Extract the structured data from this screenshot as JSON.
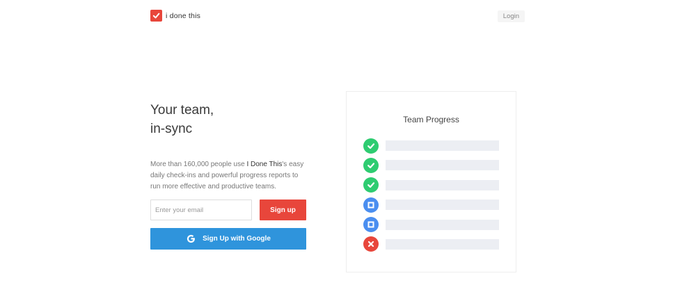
{
  "header": {
    "logo_text": "i done this",
    "login_label": "Login"
  },
  "hero": {
    "headline_line1": "Your team,",
    "headline_line2": "in-sync",
    "description_before": "More than 160,000 people use ",
    "description_brand": "I Done This",
    "description_after": "'s easy daily check-ins and powerful progress reports to run more effective and productive teams."
  },
  "signup": {
    "email_placeholder": "Enter your email",
    "signup_label": "Sign up",
    "google_label": "Sign Up with Google"
  },
  "card": {
    "title": "Team Progress",
    "rows": [
      {
        "status": "done",
        "icon": "check-circle-icon"
      },
      {
        "status": "done",
        "icon": "check-circle-icon"
      },
      {
        "status": "done",
        "icon": "check-circle-icon"
      },
      {
        "status": "pending",
        "icon": "square-circle-icon"
      },
      {
        "status": "pending",
        "icon": "square-circle-icon"
      },
      {
        "status": "blocked",
        "icon": "x-circle-icon"
      }
    ]
  },
  "colors": {
    "brand_red": "#e8463b",
    "google_blue": "#2f94dc",
    "done_green": "#2ecc71",
    "pending_blue": "#4a8ef0"
  }
}
